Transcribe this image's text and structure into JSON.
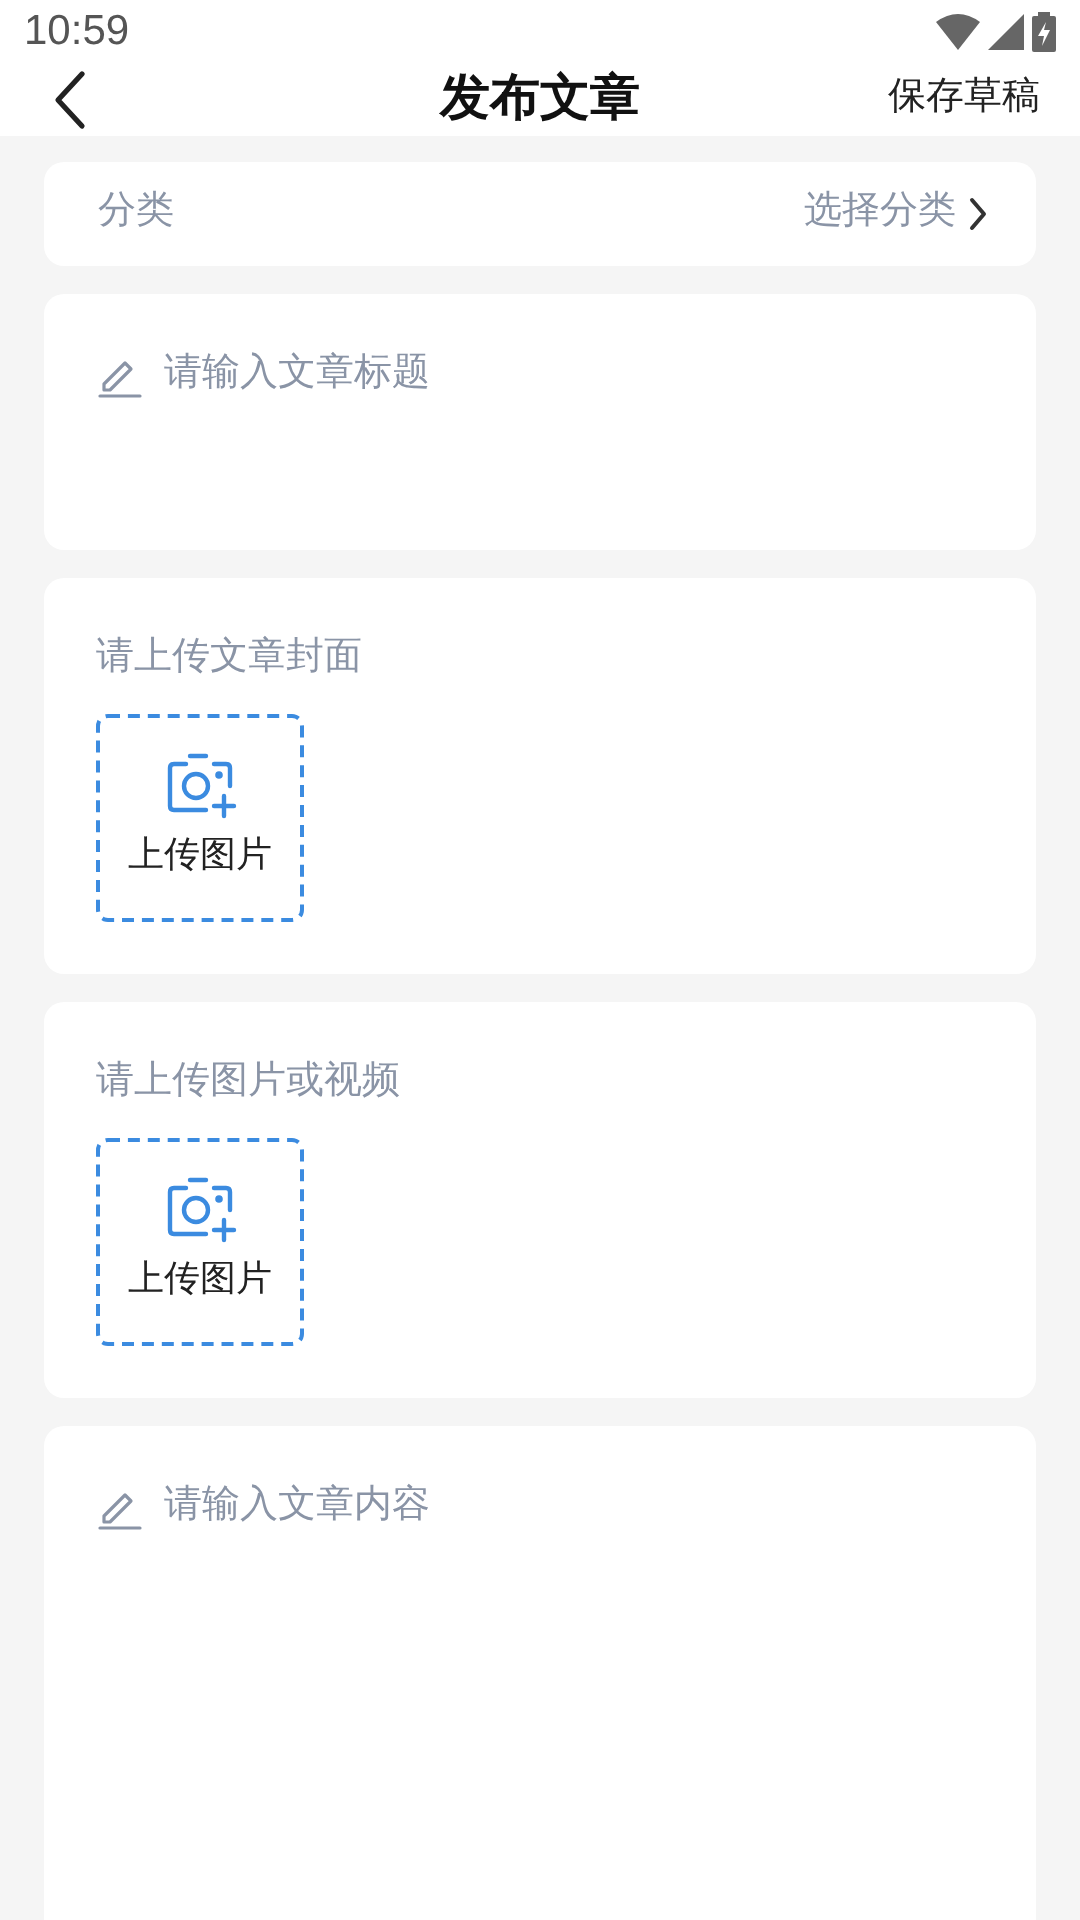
{
  "status_bar": {
    "time": "10:59"
  },
  "header": {
    "title": "发布文章",
    "action": "保存草稿"
  },
  "category": {
    "label": "分类",
    "action": "选择分类"
  },
  "title_field": {
    "placeholder": "请输入文章标题"
  },
  "uploads": [
    {
      "label": "请上传文章封面",
      "button": "上传图片"
    },
    {
      "label": "请上传图片或视频",
      "button": "上传图片"
    }
  ],
  "content_field": {
    "placeholder": "请输入文章内容"
  }
}
